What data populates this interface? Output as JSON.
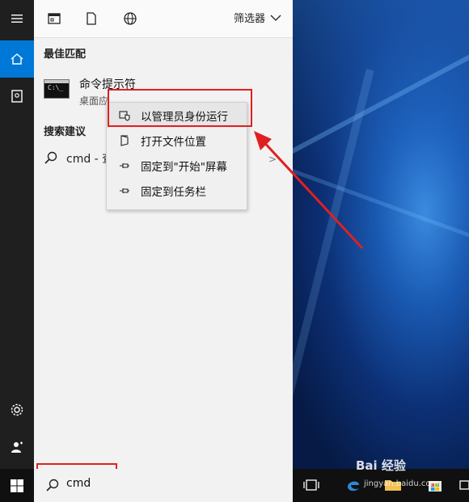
{
  "toolbar": {
    "filter_label": "筛选器"
  },
  "best_match": {
    "section_title": "最佳匹配",
    "app_name": "命令提示符",
    "app_subtitle": "桌面应"
  },
  "suggestions": {
    "section_title": "搜索建议",
    "item_text": "cmd - 查"
  },
  "context_menu": {
    "items": [
      {
        "label": "以管理员身份运行",
        "icon": "shield-icon"
      },
      {
        "label": "打开文件位置",
        "icon": "folder-open-icon"
      },
      {
        "label": "固定到\"开始\"屏幕",
        "icon": "pin-icon"
      },
      {
        "label": "固定到任务栏",
        "icon": "pin-icon"
      }
    ]
  },
  "taskbar": {
    "search_query": "cmd"
  },
  "watermark": {
    "brand": "Bai 经验",
    "url": "jingyan.baidu.com"
  },
  "colors": {
    "accent": "#0078d7",
    "annotation": "#e02020"
  }
}
